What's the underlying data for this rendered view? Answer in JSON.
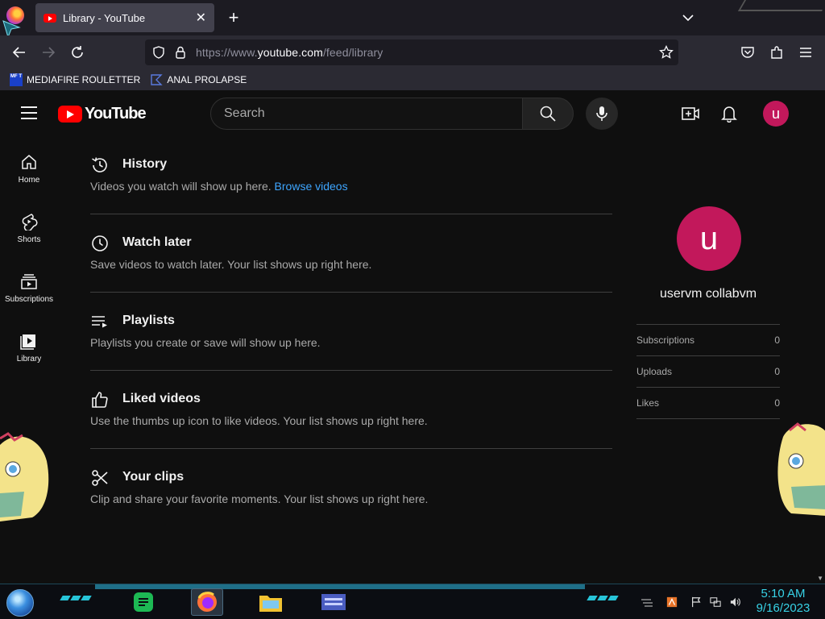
{
  "browser": {
    "tab_title": "Library - YouTube",
    "url_prefix": "https://www.",
    "url_domain": "youtube.com",
    "url_path": "/feed/library",
    "bookmarks": [
      {
        "label": "MEDIAFIRE ROULETTER",
        "icon_text": "MF T"
      },
      {
        "label": "ANAL PROLAPSE"
      }
    ]
  },
  "youtube": {
    "logo_text": "YouTube",
    "search_placeholder": "Search",
    "avatar_letter": "u",
    "guide": [
      {
        "label": "Home",
        "icon": "home-icon"
      },
      {
        "label": "Shorts",
        "icon": "shorts-icon"
      },
      {
        "label": "Subscriptions",
        "icon": "subscriptions-icon"
      },
      {
        "label": "Library",
        "icon": "library-icon"
      }
    ],
    "sections": [
      {
        "title": "History",
        "desc": "Videos you watch will show up here. ",
        "link": "Browse videos",
        "icon": "history-icon"
      },
      {
        "title": "Watch later",
        "desc": "Save videos to watch later. Your list shows up right here.",
        "icon": "clock-icon"
      },
      {
        "title": "Playlists",
        "desc": "Playlists you create or save will show up here.",
        "icon": "playlist-icon"
      },
      {
        "title": "Liked videos",
        "desc": "Use the thumbs up icon to like videos. Your list shows up right here.",
        "icon": "thumbs-up-icon"
      },
      {
        "title": "Your clips",
        "desc": "Clip and share your favorite moments. Your list shows up right here.",
        "icon": "scissors-icon"
      }
    ],
    "profile": {
      "letter": "u",
      "name": "uservm collabvm",
      "stats": [
        {
          "label": "Subscriptions",
          "value": "0"
        },
        {
          "label": "Uploads",
          "value": "0"
        },
        {
          "label": "Likes",
          "value": "0"
        }
      ]
    },
    "colors": {
      "brand_red": "#ff0000",
      "avatar": "#c2185b",
      "link": "#3ea6ff"
    }
  },
  "taskbar": {
    "time": "5:10 AM",
    "date": "9/16/2023"
  }
}
